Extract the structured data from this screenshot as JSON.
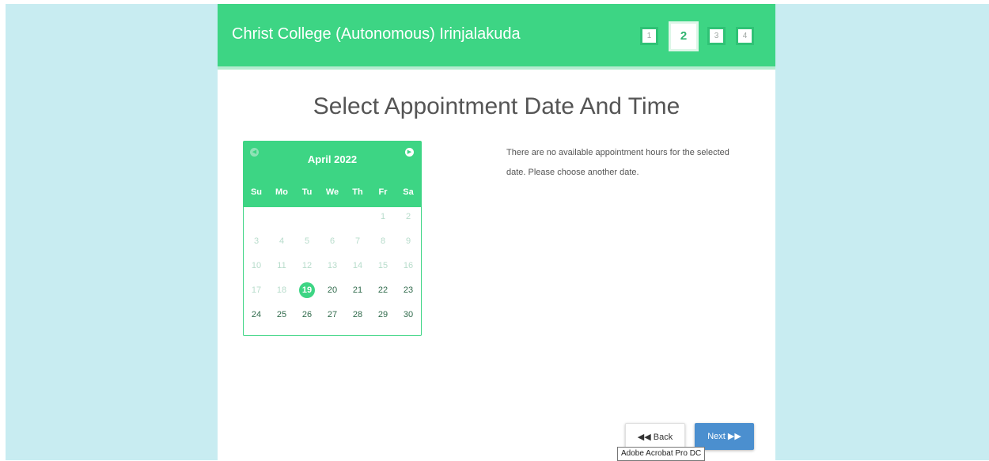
{
  "header": {
    "brand": "Christ College (Autonomous) Irinjalakuda",
    "steps": [
      "1",
      "2",
      "3",
      "4"
    ],
    "active_step": "2"
  },
  "page_title": "Select Appointment Date And Time",
  "calendar": {
    "month_label": "April 2022",
    "prev_icon": "chevron-left-circle-icon",
    "next_icon": "chevron-right-circle-icon",
    "weekdays": [
      "Su",
      "Mo",
      "Tu",
      "We",
      "Th",
      "Fr",
      "Sa"
    ],
    "weeks": [
      [
        "",
        "",
        "",
        "",
        "",
        "1",
        "2"
      ],
      [
        "3",
        "4",
        "5",
        "6",
        "7",
        "8",
        "9"
      ],
      [
        "10",
        "11",
        "12",
        "13",
        "14",
        "15",
        "16"
      ],
      [
        "17",
        "18",
        "19",
        "20",
        "21",
        "22",
        "23"
      ],
      [
        "24",
        "25",
        "26",
        "27",
        "28",
        "29",
        "30"
      ]
    ],
    "selected_day": "19",
    "disabled_days": [
      "1",
      "2",
      "3",
      "4",
      "5",
      "6",
      "7",
      "8",
      "9",
      "10",
      "11",
      "12",
      "13",
      "14",
      "15",
      "16",
      "17",
      "18"
    ]
  },
  "message": "There are no available appointment hours for the selected date. Please choose another date.",
  "buttons": {
    "back_label": "Back",
    "next_label": "Next"
  },
  "tooltip": "Adobe Acrobat Pro DC",
  "colors": {
    "accent": "#3dd584",
    "page_bg": "#c8ecf1",
    "next_button": "#4b8fcf"
  }
}
